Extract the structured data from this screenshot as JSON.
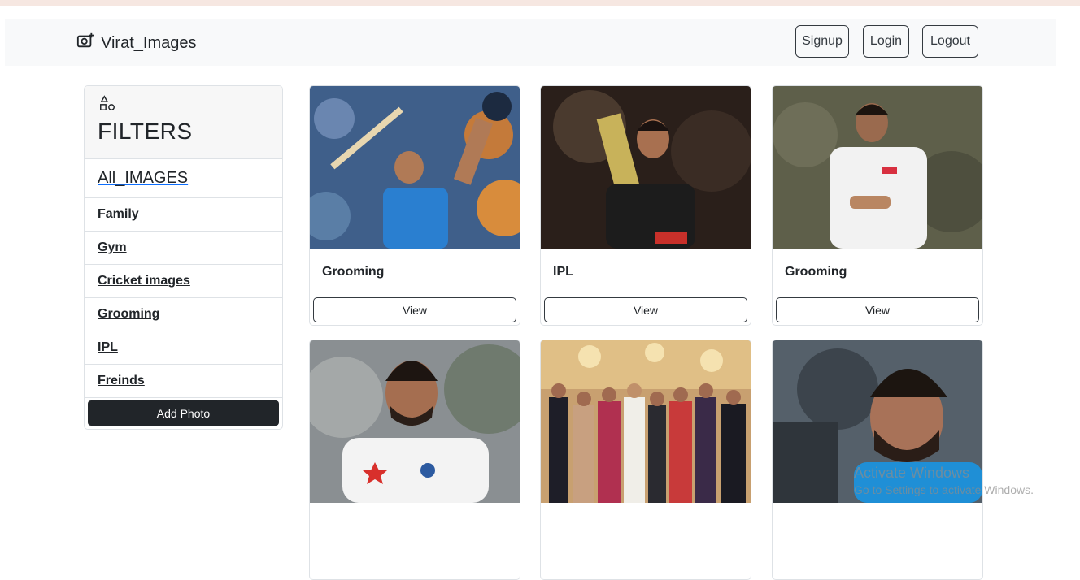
{
  "navbar": {
    "brand": "Virat_Images",
    "buttons": {
      "signup": "Signup",
      "login": "Login",
      "logout": "Logout"
    }
  },
  "sidebar": {
    "title": "FILTERS",
    "all_images": "All_IMAGES",
    "categories": [
      "Family",
      "Gym",
      "Cricket images",
      "Grooming",
      "IPL",
      "Freinds"
    ],
    "add_photo": "Add Photo"
  },
  "cards": [
    {
      "title": "Grooming",
      "button": "View"
    },
    {
      "title": "IPL",
      "button": "View"
    },
    {
      "title": "Grooming",
      "button": "View"
    }
  ],
  "watermark": {
    "line1": "Activate Windows",
    "line2": "Go to Settings to activate Windows."
  },
  "colors": {
    "navbar_bg": "#f8f9fa",
    "dark_button": "#212529",
    "link_underline": "#0d6efd"
  }
}
